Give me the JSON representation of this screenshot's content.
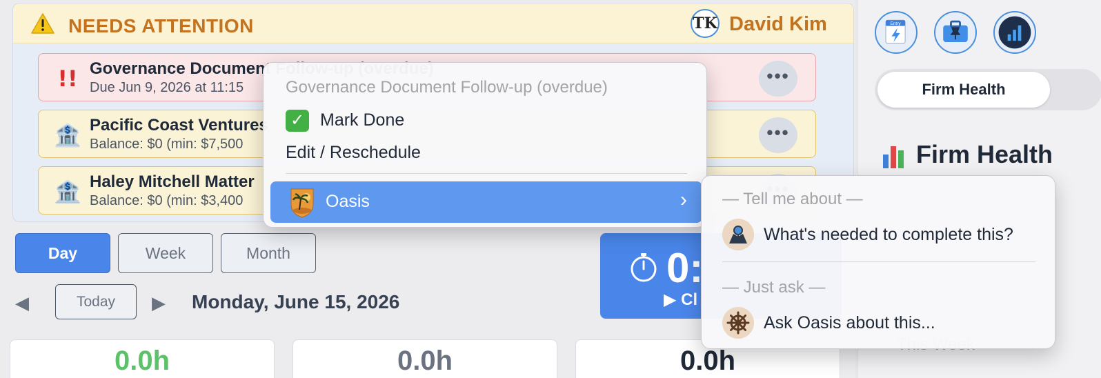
{
  "attention": {
    "title": "NEEDS ATTENTION",
    "warning_icon": "warning-triangle-icon",
    "user": {
      "initials": "TK",
      "name": "David Kim"
    },
    "items": [
      {
        "icon": "double-exclamation-icon",
        "icon_glyph": "!!",
        "title": "Governance Document Follow-up (overdue)",
        "subtitle": "Due Jun 9, 2026 at 11:15",
        "more": "•••"
      },
      {
        "icon": "bank-icon",
        "icon_glyph": "🏦",
        "title": "Pacific Coast Ventures",
        "subtitle": "Balance: $0 (min: $7,500",
        "more": "•••"
      },
      {
        "icon": "bank-icon",
        "icon_glyph": "🏦",
        "title": "Haley Mitchell Matter",
        "subtitle": "Balance: $0 (min: $3,400",
        "more": "•••"
      }
    ]
  },
  "views": {
    "day": "Day",
    "week": "Week",
    "month": "Month",
    "active": "Day"
  },
  "nav": {
    "prev": "◀",
    "today": "Today",
    "next": "▶",
    "date": "Monday, June 15, 2026"
  },
  "timer": {
    "value": "0:",
    "clock_label": "▶ Cl",
    "icon": "stopwatch-icon"
  },
  "stats": [
    {
      "value": "0.0h",
      "color": "#5cc26a"
    },
    {
      "value": "0.0h",
      "color": "#6b7280"
    },
    {
      "value": "0.0h",
      "color": "#1f2937"
    }
  ],
  "sidebar": {
    "icons": [
      "entry-lightning-icon",
      "briefcase-pin-icon",
      "chart-gauge-icon"
    ],
    "entry_label": "Entry",
    "segment_active": "Firm Health",
    "section_title": "Firm Health",
    "section_icon": "bar-chart-icon",
    "partial_label": "This Week"
  },
  "context_menu": {
    "header": "Governance Document Follow-up (overdue)",
    "mark_done": "Mark Done",
    "edit": "Edit / Reschedule",
    "oasis": "Oasis",
    "chevron": "›"
  },
  "submenu": {
    "section1": "— Tell me about —",
    "needed": "What's needed to complete this?",
    "section2": "— Just ask —",
    "ask": "Ask Oasis about this..."
  },
  "colors": {
    "accent": "#4a86ea",
    "warning": "#c3731f",
    "menu_highlight": "#5f99ef"
  }
}
